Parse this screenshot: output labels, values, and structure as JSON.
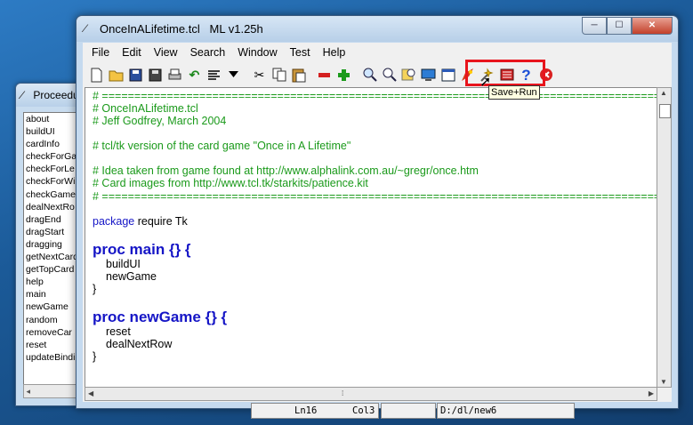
{
  "procedures_window": {
    "title": "Proceedures",
    "items": [
      "about",
      "buildUI",
      "cardInfo",
      "checkForGa",
      "checkForLe",
      "checkForWi",
      "checkGame",
      "dealNextRo",
      "dragEnd",
      "dragStart",
      "dragging",
      "getNextCard",
      "getTopCard",
      "help",
      "main",
      "newGame",
      "random",
      "removeCar",
      "reset",
      "updateBindi"
    ]
  },
  "main_window": {
    "title": "OnceInALifetime.tcl   ML v1.25h",
    "controls": {
      "minimize": "─",
      "maximize": "☐",
      "close": "✕"
    }
  },
  "menu": [
    "File",
    "Edit",
    "View",
    "Search",
    "Window",
    "Test",
    "Help"
  ],
  "toolbar": {
    "icons": [
      "new-file-icon",
      "open-folder-icon",
      "save-icon",
      "save-all-icon",
      "print-icon",
      "undo-icon",
      "format-icon",
      "dropdown-arrow-icon",
      "cut-icon",
      "copy-icon",
      "paste-icon",
      "minus-icon",
      "plus-icon",
      "find-icon",
      "find-replace-icon",
      "goto-icon",
      "console-icon",
      "window-icon",
      "run-icon",
      "save-run-icon",
      "procedures-icon",
      "help-icon",
      "exit-icon"
    ],
    "tooltip": "Save+Run"
  },
  "code_lines": [
    {
      "type": "comment",
      "text": "# ============================================================================================"
    },
    {
      "type": "comment",
      "text": "# OnceInALifetime.tcl"
    },
    {
      "type": "comment",
      "text": "# Jeff Godfrey, March 2004"
    },
    {
      "type": "blank",
      "text": ""
    },
    {
      "type": "comment",
      "text": "# tcl/tk version of the card game \"Once in A Lifetime\""
    },
    {
      "type": "blank",
      "text": ""
    },
    {
      "type": "comment",
      "text": "# Idea taken from game found at http://www.alphalink.com.au/~gregr/once.htm"
    },
    {
      "type": "comment",
      "text": "# Card images from http://www.tcl.tk/starkits/patience.kit"
    },
    {
      "type": "comment",
      "text": "# ============================================================================================"
    },
    {
      "type": "blank",
      "text": ""
    },
    {
      "type": "package",
      "kw": "package",
      "text": " require Tk"
    },
    {
      "type": "blank",
      "text": ""
    },
    {
      "type": "proc",
      "text": "proc main {} {"
    },
    {
      "type": "indent",
      "text": "buildUI"
    },
    {
      "type": "indent",
      "text": "newGame"
    },
    {
      "type": "normal",
      "text": "}"
    },
    {
      "type": "blank",
      "text": ""
    },
    {
      "type": "proc",
      "text": "proc newGame {} {"
    },
    {
      "type": "indent",
      "text": "reset"
    },
    {
      "type": "indent",
      "text": "dealNextRow"
    },
    {
      "type": "normal",
      "text": "}"
    }
  ],
  "status": {
    "line": "Ln16",
    "col": "Col3",
    "path": "D:/dl/new6"
  }
}
